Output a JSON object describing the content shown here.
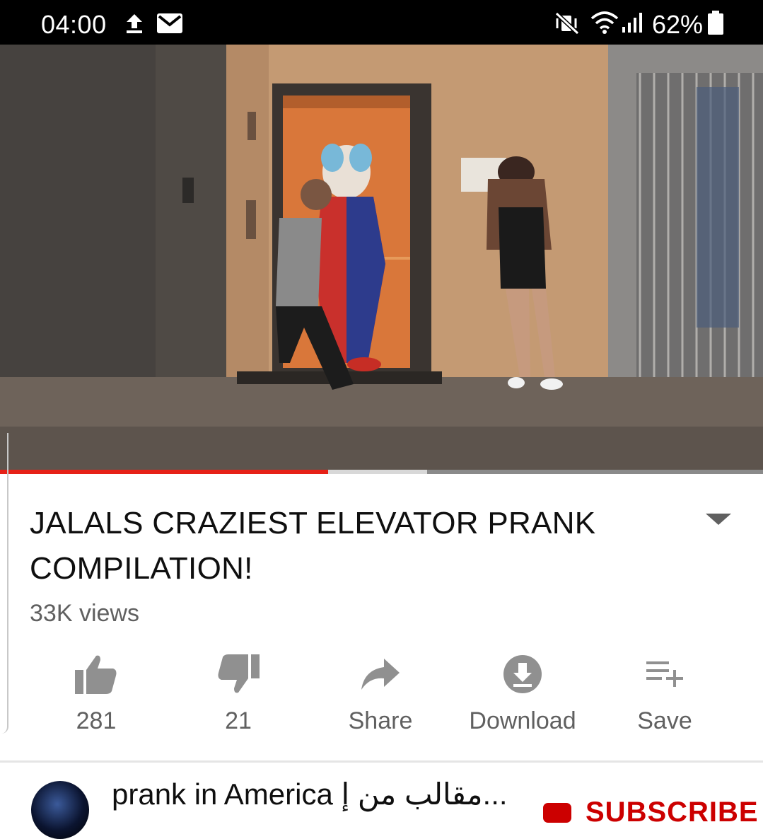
{
  "status_bar": {
    "time": "04:00",
    "icons": [
      "upload-icon",
      "mail-icon",
      "mute-vibrate-icon",
      "wifi-icon",
      "signal-icon",
      "battery-icon"
    ],
    "battery": "62%"
  },
  "player": {
    "progress_fraction": 0.43,
    "buffer_fraction": 0.56,
    "accent": "#e62117"
  },
  "video": {
    "title": "JALALS CRAZIEST ELEVATOR PRANK COMPILATION!",
    "views": "33K views"
  },
  "actions": [
    {
      "icon": "thumbs-up-icon",
      "label": "281"
    },
    {
      "icon": "thumbs-down-icon",
      "label": "21"
    },
    {
      "icon": "share-icon",
      "label": "Share"
    },
    {
      "icon": "download-icon",
      "label": "Download"
    },
    {
      "icon": "save-playlist-icon",
      "label": "Save"
    }
  ],
  "channel": {
    "name": "prank in America مقالب من إ...",
    "subscribe_label": "SUBSCRIBE"
  },
  "colors": {
    "text_primary": "#0f0f0f",
    "text_secondary": "#606060",
    "icon": "#909090",
    "subscribe": "#cc0000"
  }
}
